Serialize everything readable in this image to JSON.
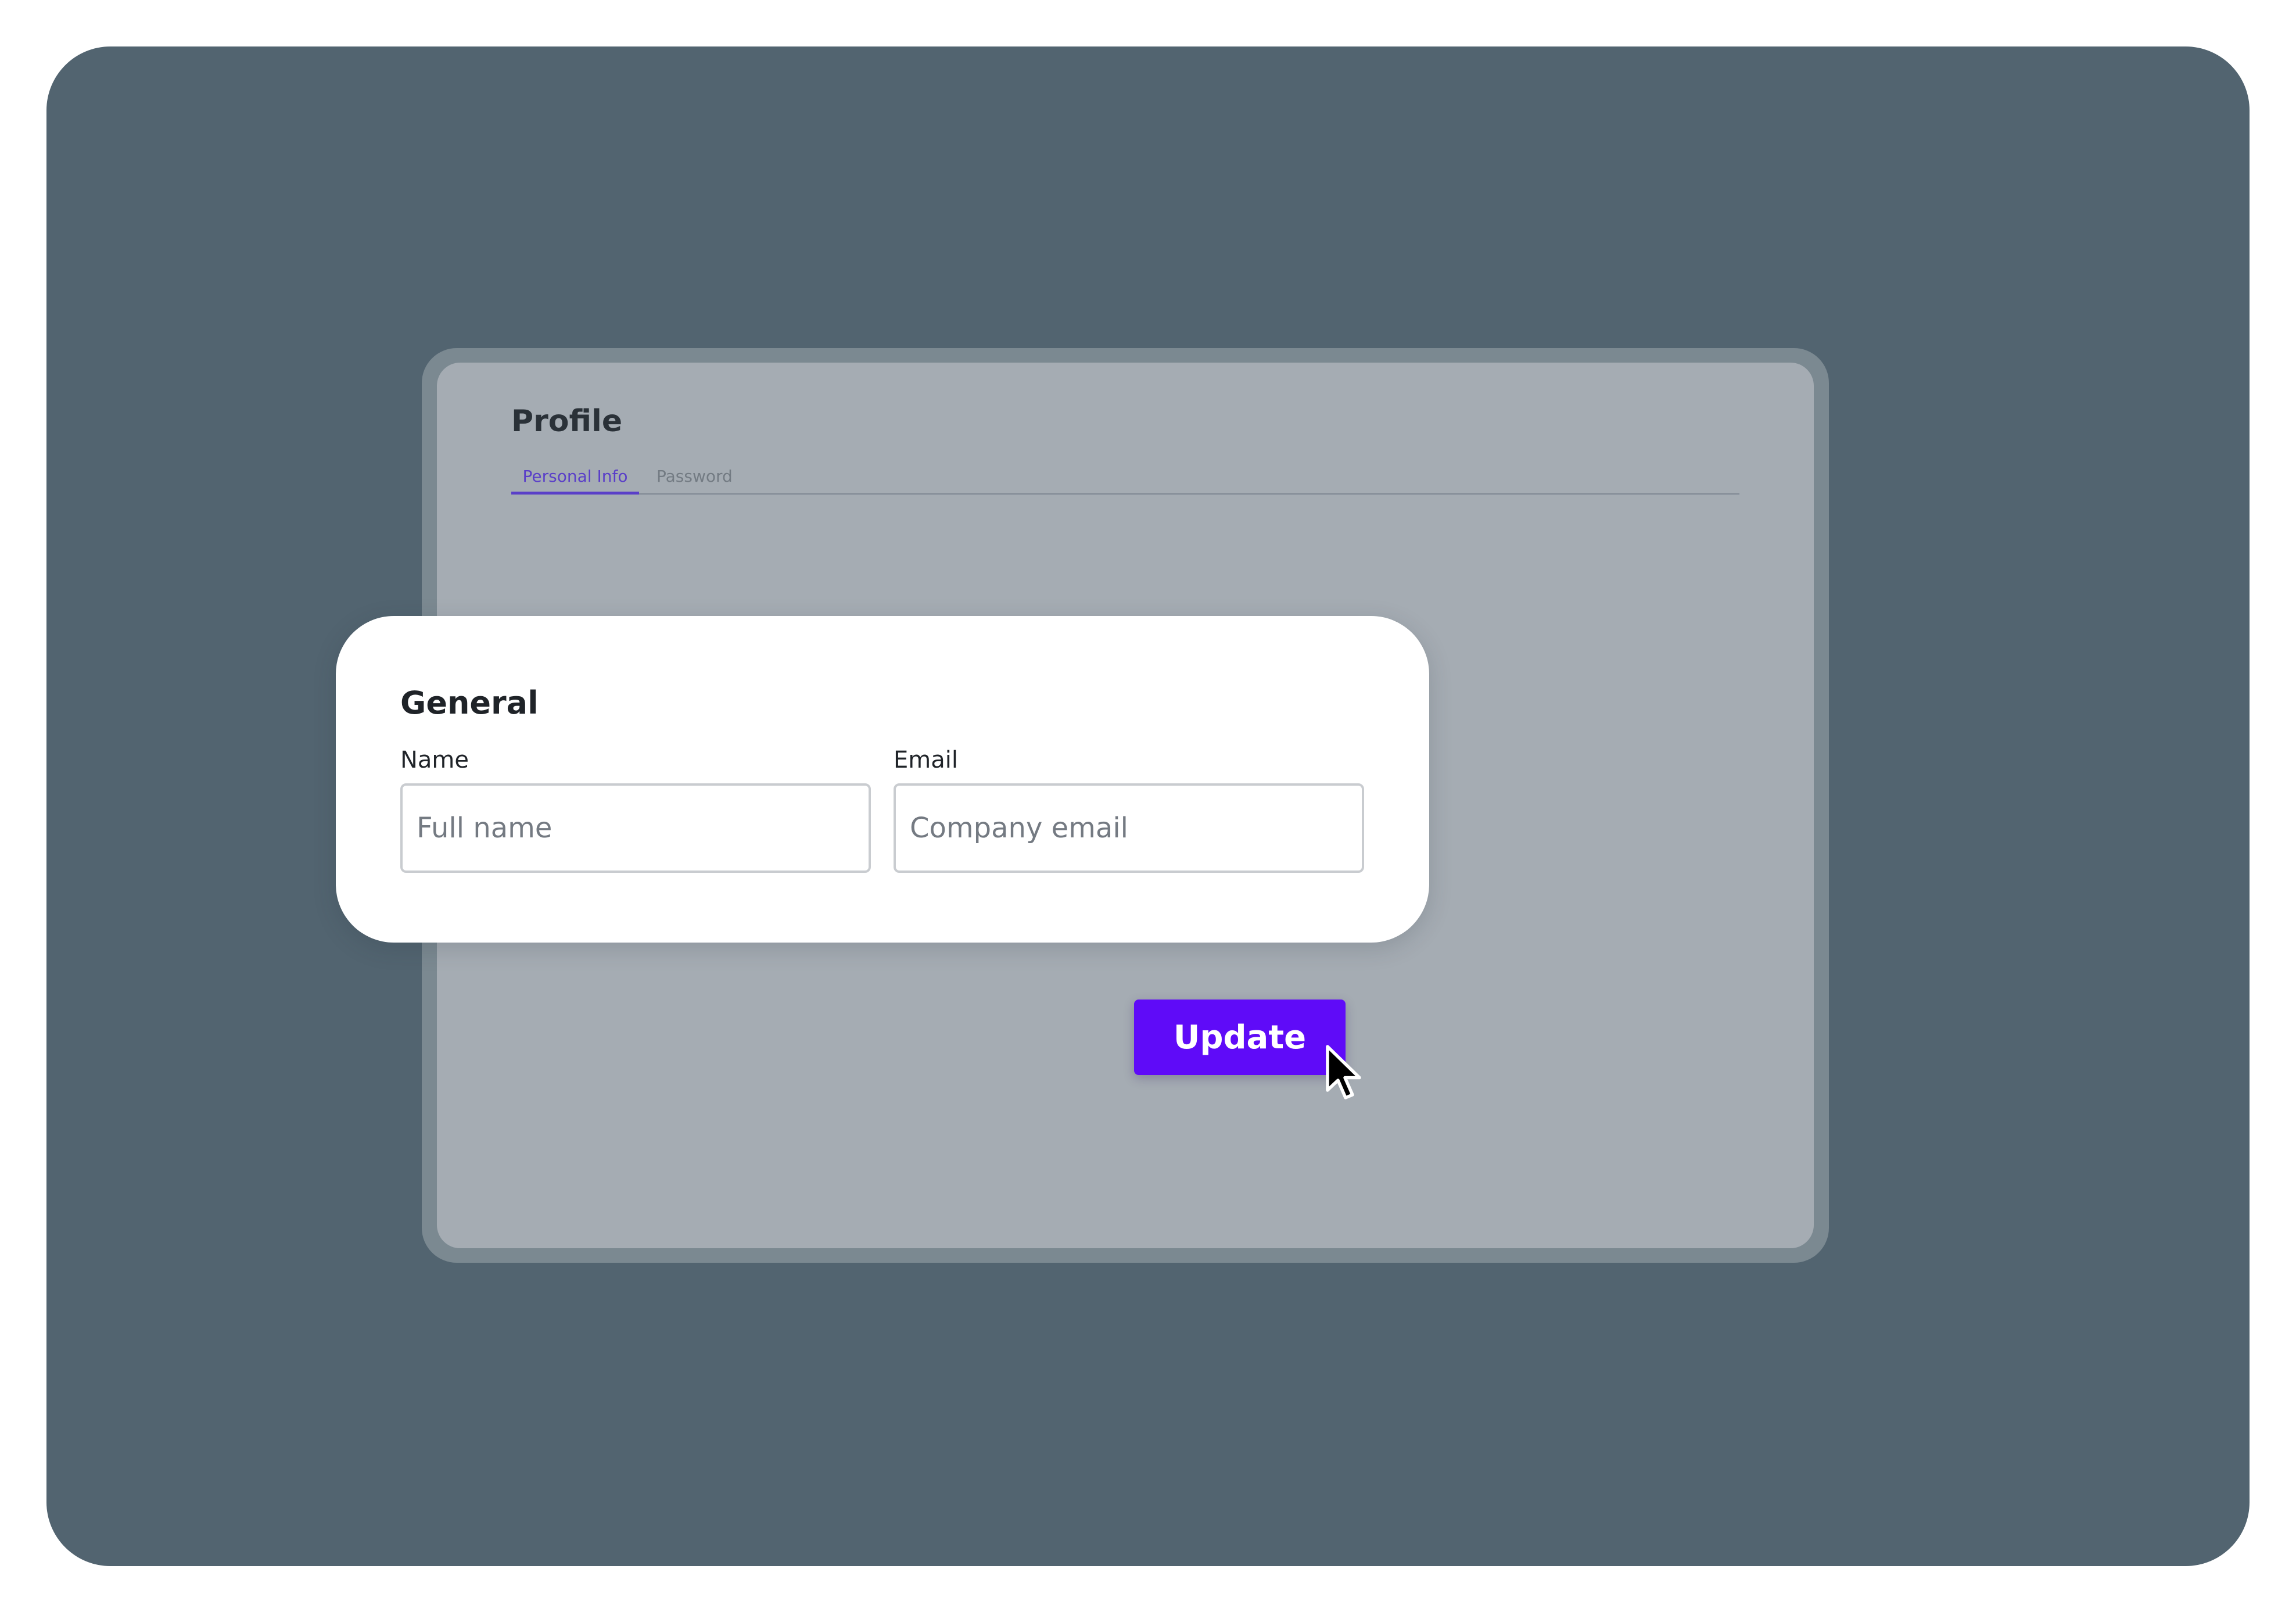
{
  "profile": {
    "title": "Profile",
    "tabs": [
      {
        "label": "Personal Info",
        "active": true
      },
      {
        "label": "Password",
        "active": false
      }
    ]
  },
  "general": {
    "title": "General",
    "name": {
      "label": "Name",
      "value": "",
      "placeholder": "Full name"
    },
    "email": {
      "label": "Email",
      "value": "",
      "placeholder": "Company email"
    }
  },
  "actions": {
    "update_label": "Update"
  },
  "icons": {
    "cursor": "mouse-pointer-icon"
  },
  "colors": {
    "accent": "#5f0bf8",
    "tab_active": "#5a3fc8",
    "backdrop": "#526470",
    "panel": "#a5acb3"
  }
}
